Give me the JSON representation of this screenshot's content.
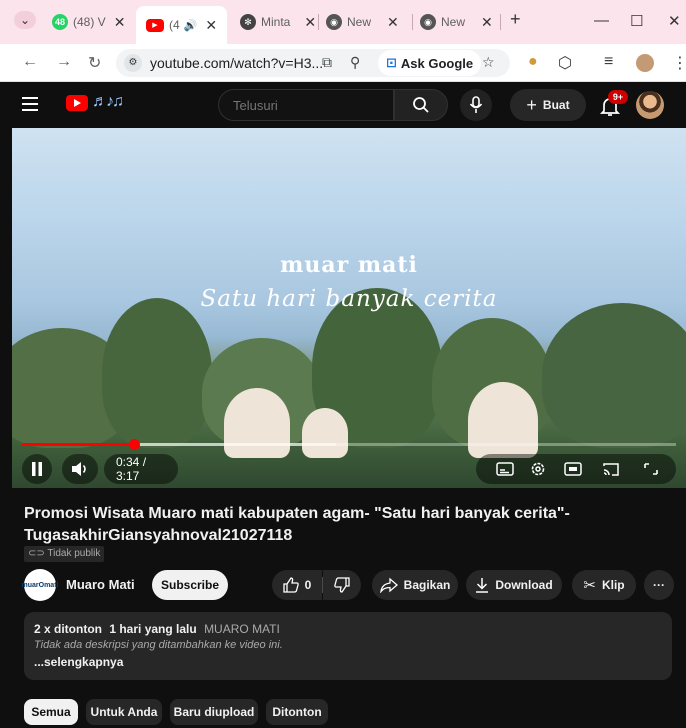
{
  "browser": {
    "tabs": [
      {
        "label": "(48) V",
        "icon": "whatsapp-icon"
      },
      {
        "label": "(4",
        "icon": "youtube-icon",
        "audio": true
      },
      {
        "label": "Minta",
        "icon": "chatgpt-icon"
      },
      {
        "label": "New",
        "icon": "chrome-icon"
      },
      {
        "label": "New",
        "icon": "chrome-icon"
      }
    ],
    "favicon_text": [
      "48",
      "▶",
      "✻",
      "◉",
      "◉"
    ],
    "url": "youtube.com/watch?v=H3...",
    "ask_google": "Ask Google"
  },
  "youtube": {
    "search_placeholder": "Telusuri",
    "create_label": "Buat",
    "notifications": "9+"
  },
  "player": {
    "brand_logo": "muar  mati",
    "tagline": "Satu hari banyak cerita",
    "time": "0:34 / 3:17",
    "progress": 0.172,
    "buffered": 0.48
  },
  "video": {
    "title": "Promosi Wisata Muaro mati kabupaten agam- \"Satu hari banyak cerita\"-TugasakhirGiansyahnoval21027118",
    "visibility": "Tidak publik",
    "channel_name": "Muaro Mati",
    "channel_avatar_text": "muarOmati",
    "subscribe": "Subscribe",
    "likes": "0",
    "share": "Bagikan",
    "download": "Download",
    "clip": "Klip",
    "more": "···"
  },
  "description": {
    "views": "2 x ditonton",
    "age": "1 hari yang lalu",
    "channel_tag": "MUARO MATI",
    "text": "Tidak ada deskripsi yang ditambahkan ke video ini.",
    "more": "...selengkapnya"
  },
  "chips": [
    "Semua",
    "Untuk Anda",
    "Baru diupload",
    "Ditonton"
  ],
  "colors": {
    "accent": "#ff0000",
    "background": "#0f0f0f",
    "tab_strip": "#fbe4ec"
  }
}
